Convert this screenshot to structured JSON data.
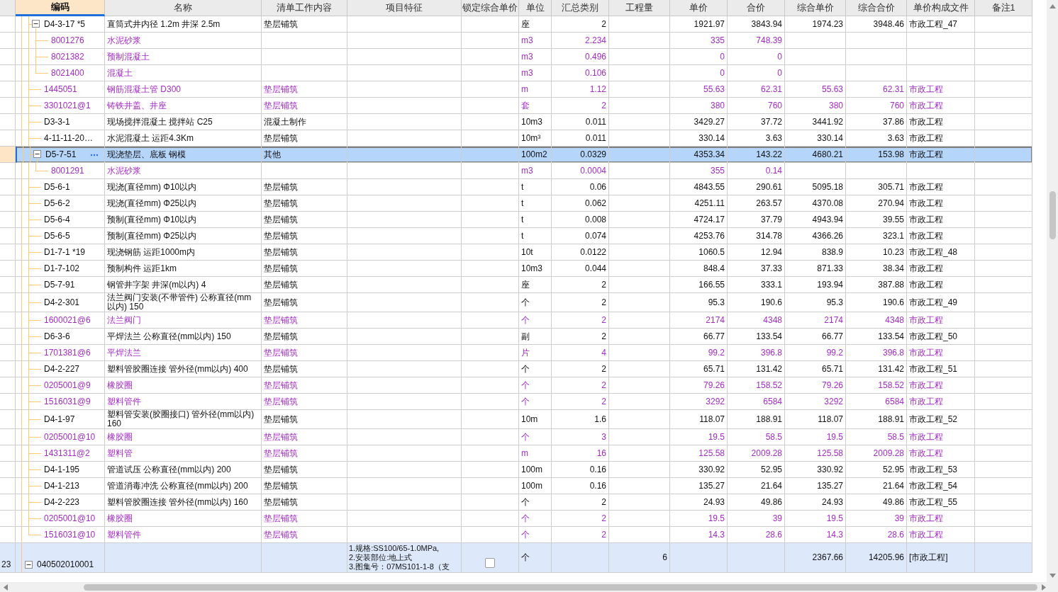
{
  "columns": [
    {
      "label": "编码",
      "selected": true
    },
    {
      "label": "名称",
      "selected": false
    },
    {
      "label": "清单工作内容",
      "selected": false
    },
    {
      "label": "项目特征",
      "selected": false
    },
    {
      "label": "锁定综合单价",
      "selected": false
    },
    {
      "label": "单位",
      "selected": false
    },
    {
      "label": "汇总类别",
      "selected": false
    },
    {
      "label": "工程量",
      "selected": false
    },
    {
      "label": "单价",
      "selected": false
    },
    {
      "label": "合价",
      "selected": false
    },
    {
      "label": "综合单价",
      "selected": false
    },
    {
      "label": "综合合价",
      "selected": false
    },
    {
      "label": "单价构成文件",
      "selected": false
    },
    {
      "label": "备注1",
      "selected": false
    }
  ],
  "rows": [
    {
      "kind": "quota",
      "selected": false,
      "expanded": true,
      "code": "D4-3-17 *5",
      "name": "直筒式井内径 1.2m 井深 2.5m",
      "content": "垫层铺筑",
      "unit": "座",
      "quantity": "2",
      "unit_price": "1921.97",
      "amount": "3843.94",
      "composite_unit_price": "1974.23",
      "composite_amount": "3948.46",
      "price_file": "市政工程_47",
      "children": [
        {
          "kind": "material",
          "code": "8001276",
          "name": "水泥砂浆",
          "unit": "m3",
          "quantity": "2.234",
          "unit_price": "335",
          "amount": "748.39"
        },
        {
          "kind": "material",
          "code": "8021382",
          "name": "预制混凝土",
          "unit": "m3",
          "quantity": "0.496",
          "unit_price": "0",
          "amount": "0"
        },
        {
          "kind": "material",
          "code": "8021400",
          "name": "混凝土",
          "unit": "m3",
          "quantity": "0.106",
          "unit_price": "0",
          "amount": "0"
        }
      ]
    },
    {
      "kind": "material",
      "selected": false,
      "code": "1445051",
      "name": "钢筋混凝土管 D300",
      "content": "垫层铺筑",
      "unit": "m",
      "quantity": "1.12",
      "unit_price": "55.63",
      "amount": "62.31",
      "composite_unit_price": "55.63",
      "composite_amount": "62.31",
      "price_file": "市政工程"
    },
    {
      "kind": "material",
      "selected": false,
      "code": "3301021@1",
      "name": "铸铁井盖、井座",
      "content": "垫层铺筑",
      "unit": "套",
      "quantity": "2",
      "unit_price": "380",
      "amount": "760",
      "composite_unit_price": "380",
      "composite_amount": "760",
      "price_file": "市政工程"
    },
    {
      "kind": "quota",
      "selected": false,
      "code": "D3-3-1",
      "name": "现场搅拌混凝土 搅拌站 C25",
      "content": "混凝土制作",
      "unit": "10m3",
      "quantity": "0.011",
      "unit_price": "3429.27",
      "amount": "37.72",
      "composite_unit_price": "3441.92",
      "composite_amount": "37.86",
      "price_file": "市政工程"
    },
    {
      "kind": "quota",
      "selected": false,
      "code": "4-11-11-20…",
      "name": "水泥混凝土 运距4.3Km",
      "content": "垫层铺筑",
      "unit": "10m³",
      "quantity": "0.011",
      "unit_price": "330.14",
      "amount": "3.63",
      "composite_unit_price": "330.14",
      "composite_amount": "3.63",
      "price_file": "市政工程"
    },
    {
      "kind": "quota",
      "selected": true,
      "expanded": true,
      "code": "D5-7-51",
      "name": "现浇垫层、底板 钢模",
      "content": "其他",
      "unit": "100m2",
      "quantity": "0.0329",
      "unit_price": "4353.34",
      "amount": "143.22",
      "composite_unit_price": "4680.21",
      "composite_amount": "153.98",
      "price_file": "市政工程",
      "children": [
        {
          "kind": "material",
          "code": "8001291",
          "name": "水泥砂浆",
          "unit": "m3",
          "quantity": "0.0004",
          "unit_price": "355",
          "amount": "0.14"
        }
      ]
    },
    {
      "kind": "quota",
      "selected": false,
      "code": "D5-6-1",
      "name": "现浇(直径mm) Φ10以内",
      "content": "垫层铺筑",
      "unit": "t",
      "quantity": "0.06",
      "unit_price": "4843.55",
      "amount": "290.61",
      "composite_unit_price": "5095.18",
      "composite_amount": "305.71",
      "price_file": "市政工程"
    },
    {
      "kind": "quota",
      "selected": false,
      "code": "D5-6-2",
      "name": "现浇(直径mm) Φ25以内",
      "content": "垫层铺筑",
      "unit": "t",
      "quantity": "0.062",
      "unit_price": "4251.11",
      "amount": "263.57",
      "composite_unit_price": "4370.08",
      "composite_amount": "270.94",
      "price_file": "市政工程"
    },
    {
      "kind": "quota",
      "selected": false,
      "code": "D5-6-4",
      "name": "预制(直径mm) Φ10以内",
      "content": "垫层铺筑",
      "unit": "t",
      "quantity": "0.008",
      "unit_price": "4724.17",
      "amount": "37.79",
      "composite_unit_price": "4943.94",
      "composite_amount": "39.55",
      "price_file": "市政工程"
    },
    {
      "kind": "quota",
      "selected": false,
      "code": "D5-6-5",
      "name": "预制(直径mm) Φ25以内",
      "content": "垫层铺筑",
      "unit": "t",
      "quantity": "0.074",
      "unit_price": "4253.76",
      "amount": "314.78",
      "composite_unit_price": "4366.26",
      "composite_amount": "323.1",
      "price_file": "市政工程"
    },
    {
      "kind": "quota",
      "selected": false,
      "code": "D1-7-1 *19",
      "name": "现浇钢筋 运距1000m内",
      "content": "垫层铺筑",
      "unit": "10t",
      "quantity": "0.0122",
      "unit_price": "1060.5",
      "amount": "12.94",
      "composite_unit_price": "838.9",
      "composite_amount": "10.23",
      "price_file": "市政工程_48"
    },
    {
      "kind": "quota",
      "selected": false,
      "code": "D1-7-102",
      "name": "预制构件 运距1km",
      "content": "垫层铺筑",
      "unit": "10m3",
      "quantity": "0.044",
      "unit_price": "848.4",
      "amount": "37.33",
      "composite_unit_price": "871.33",
      "composite_amount": "38.34",
      "price_file": "市政工程"
    },
    {
      "kind": "quota",
      "selected": false,
      "code": "D5-7-91",
      "name": "钢管井字架 井深(m以内) 4",
      "content": "垫层铺筑",
      "unit": "座",
      "quantity": "2",
      "unit_price": "166.55",
      "amount": "333.1",
      "composite_unit_price": "193.94",
      "composite_amount": "387.88",
      "price_file": "市政工程"
    },
    {
      "kind": "quota",
      "selected": false,
      "code": "D4-2-301",
      "name": "法兰阀门安装(不带管件) 公称直径(mm以内) 150",
      "content": "垫层铺筑",
      "unit": "个",
      "quantity": "2",
      "unit_price": "95.3",
      "amount": "190.6",
      "composite_unit_price": "95.3",
      "composite_amount": "190.6",
      "price_file": "市政工程_49"
    },
    {
      "kind": "material",
      "selected": false,
      "code": "1600021@6",
      "name": "法兰阀门",
      "content": "垫层铺筑",
      "unit": "个",
      "quantity": "2",
      "unit_price": "2174",
      "amount": "4348",
      "composite_unit_price": "2174",
      "composite_amount": "4348",
      "price_file": "市政工程"
    },
    {
      "kind": "quota",
      "selected": false,
      "code": "D6-3-6",
      "name": "平焊法兰 公称直径(mm以内) 150",
      "content": "垫层铺筑",
      "unit": "副",
      "quantity": "2",
      "unit_price": "66.77",
      "amount": "133.54",
      "composite_unit_price": "66.77",
      "composite_amount": "133.54",
      "price_file": "市政工程_50"
    },
    {
      "kind": "material",
      "selected": false,
      "code": "1701381@6",
      "name": "平焊法兰",
      "content": "垫层铺筑",
      "unit": "片",
      "quantity": "4",
      "unit_price": "99.2",
      "amount": "396.8",
      "composite_unit_price": "99.2",
      "composite_amount": "396.8",
      "price_file": "市政工程"
    },
    {
      "kind": "quota",
      "selected": false,
      "code": "D4-2-227",
      "name": "塑料管胶圈连接 管外径(mm以内) 400",
      "content": "垫层铺筑",
      "unit": "个",
      "quantity": "2",
      "unit_price": "65.71",
      "amount": "131.42",
      "composite_unit_price": "65.71",
      "composite_amount": "131.42",
      "price_file": "市政工程_51"
    },
    {
      "kind": "material",
      "selected": false,
      "code": "0205001@9",
      "name": "橡胶圈",
      "content": "垫层铺筑",
      "unit": "个",
      "quantity": "2",
      "unit_price": "79.26",
      "amount": "158.52",
      "composite_unit_price": "79.26",
      "composite_amount": "158.52",
      "price_file": "市政工程"
    },
    {
      "kind": "material",
      "selected": false,
      "code": "1516031@9",
      "name": "塑料管件",
      "content": "垫层铺筑",
      "unit": "个",
      "quantity": "2",
      "unit_price": "3292",
      "amount": "6584",
      "composite_unit_price": "3292",
      "composite_amount": "6584",
      "price_file": "市政工程"
    },
    {
      "kind": "quota",
      "selected": false,
      "code": "D4-1-97",
      "name": "塑料管安装(胶圈接口) 管外径(mm以内) 160",
      "content": "垫层铺筑",
      "unit": "10m",
      "quantity": "1.6",
      "unit_price": "118.07",
      "amount": "188.91",
      "composite_unit_price": "118.07",
      "composite_amount": "188.91",
      "price_file": "市政工程_52"
    },
    {
      "kind": "material",
      "selected": false,
      "code": "0205001@10",
      "name": "橡胶圈",
      "content": "垫层铺筑",
      "unit": "个",
      "quantity": "3",
      "unit_price": "19.5",
      "amount": "58.5",
      "composite_unit_price": "19.5",
      "composite_amount": "58.5",
      "price_file": "市政工程"
    },
    {
      "kind": "material",
      "selected": false,
      "code": "1431311@2",
      "name": "塑料管",
      "content": "垫层铺筑",
      "unit": "m",
      "quantity": "16",
      "unit_price": "125.58",
      "amount": "2009.28",
      "composite_unit_price": "125.58",
      "composite_amount": "2009.28",
      "price_file": "市政工程"
    },
    {
      "kind": "quota",
      "selected": false,
      "code": "D4-1-195",
      "name": "管道试压 公称直径(mm以内) 200",
      "content": "垫层铺筑",
      "unit": "100m",
      "quantity": "0.16",
      "unit_price": "330.92",
      "amount": "52.95",
      "composite_unit_price": "330.92",
      "composite_amount": "52.95",
      "price_file": "市政工程_53"
    },
    {
      "kind": "quota",
      "selected": false,
      "code": "D4-1-213",
      "name": "管道消毒冲洗 公称直径(mm以内) 200",
      "content": "垫层铺筑",
      "unit": "100m",
      "quantity": "0.16",
      "unit_price": "135.27",
      "amount": "21.64",
      "composite_unit_price": "135.27",
      "composite_amount": "21.64",
      "price_file": "市政工程_54"
    },
    {
      "kind": "quota",
      "selected": false,
      "code": "D4-2-223",
      "name": "塑料管胶圈连接 管外径(mm以内) 160",
      "content": "垫层铺筑",
      "unit": "个",
      "quantity": "2",
      "unit_price": "24.93",
      "amount": "49.86",
      "composite_unit_price": "24.93",
      "composite_amount": "49.86",
      "price_file": "市政工程_55"
    },
    {
      "kind": "material",
      "selected": false,
      "code": "0205001@10",
      "name": "橡胶圈",
      "content": "垫层铺筑",
      "unit": "个",
      "quantity": "2",
      "unit_price": "19.5",
      "amount": "39",
      "composite_unit_price": "19.5",
      "composite_amount": "39",
      "price_file": "市政工程"
    },
    {
      "kind": "material",
      "selected": false,
      "code": "1516031@10",
      "name": "塑料管件",
      "content": "垫层铺筑",
      "unit": "个",
      "quantity": "2",
      "unit_price": "14.3",
      "amount": "28.6",
      "composite_unit_price": "14.3",
      "composite_amount": "28.6",
      "price_file": "市政工程"
    }
  ],
  "bill_row": {
    "number": "23",
    "expanded": true,
    "code": "040502010001",
    "features": [
      "1.规格:SS100/65-1.0MPa,",
      "2.安装部位:地上式",
      "3.图集号：07MS101-1-8（支"
    ],
    "locked": false,
    "unit": "个",
    "quantity": "6",
    "composite_unit_price": "2367.66",
    "composite_amount": "14205.96",
    "price_file": "[市政工程]"
  }
}
